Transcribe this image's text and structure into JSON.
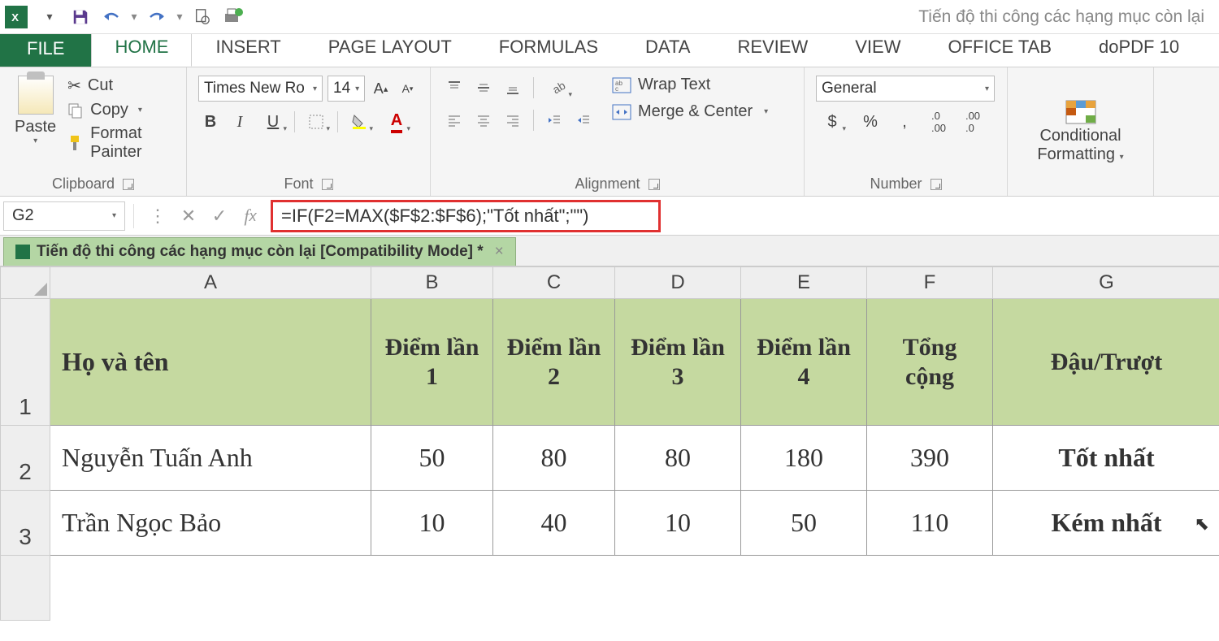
{
  "window_title": "Tiến độ thi công các hạng mục còn lại",
  "tabs": {
    "file": "FILE",
    "home": "HOME",
    "insert": "INSERT",
    "page_layout": "PAGE LAYOUT",
    "formulas": "FORMULAS",
    "data": "DATA",
    "review": "REVIEW",
    "view": "VIEW",
    "office_tab": "OFFICE TAB",
    "dopdf": "doPDF 10"
  },
  "ribbon": {
    "clipboard": {
      "label": "Clipboard",
      "paste": "Paste",
      "cut": "Cut",
      "copy": "Copy",
      "format_painter": "Format Painter"
    },
    "font": {
      "label": "Font",
      "name": "Times New Ro",
      "size": "14"
    },
    "alignment": {
      "label": "Alignment",
      "wrap": "Wrap Text",
      "merge": "Merge & Center"
    },
    "number": {
      "label": "Number",
      "format": "General"
    },
    "cond_fmt": {
      "l1": "Conditional",
      "l2": "Formatting"
    }
  },
  "name_box": "G2",
  "formula": "=IF(F2=MAX($F$2:$F$6);\"Tốt nhất\";\"\")",
  "doc_tab": "Tiến độ thi công các hạng mục còn lại  [Compatibility Mode] *",
  "columns": [
    "A",
    "B",
    "C",
    "D",
    "E",
    "F",
    "G"
  ],
  "row_numbers": [
    "1",
    "2",
    "3"
  ],
  "headers": {
    "A": "Họ và tên",
    "B": "Điểm lần 1",
    "C": "Điểm lần 2",
    "D": "Điểm lần 3",
    "E": "Điểm lần 4",
    "F": "Tổng cộng",
    "G": "Đậu/Trượt"
  },
  "rows": [
    {
      "A": "Nguyễn Tuấn Anh",
      "B": "50",
      "C": "80",
      "D": "80",
      "E": "180",
      "F": "390",
      "G": "Tốt nhất"
    },
    {
      "A": "Trần Ngọc Bảo",
      "B": "10",
      "C": "40",
      "D": "10",
      "E": "50",
      "F": "110",
      "G": "Kém nhất"
    }
  ]
}
